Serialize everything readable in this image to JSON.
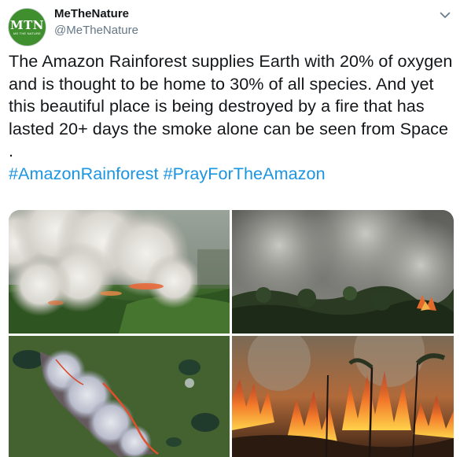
{
  "author": {
    "avatar_text": "MTN",
    "avatar_subtext": "ME THE NATURE",
    "display_name": "MeTheNature",
    "handle": "@MeTheNature"
  },
  "tweet": {
    "text": "The Amazon Rainforest supplies Earth with 20% of oxygen and is thought to be home to 30% of all species. And yet this beautiful place is being destroyed by a fire that has lasted 20+ days the smoke alone can be seen from Space .",
    "hashtags": [
      "#AmazonRainforest",
      "#PrayForTheAmazon"
    ]
  },
  "icons": {
    "menu": "chevron-down-icon"
  },
  "colors": {
    "link": "#1b95e0",
    "text": "#14171a",
    "secondary": "#657786",
    "avatar": "#3f8f2e"
  }
}
